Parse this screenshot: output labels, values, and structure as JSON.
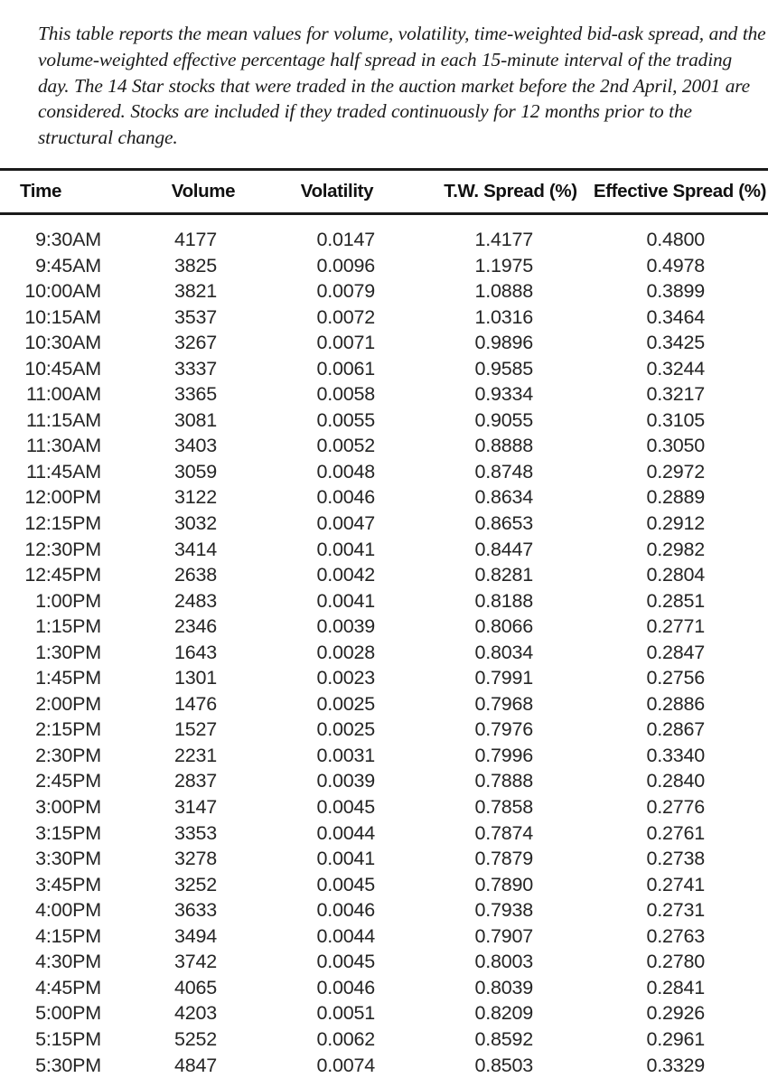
{
  "caption": {
    "text": "This table reports the mean values for volume, volatility, time-weighted bid-ask spread, and the volume-weighted effective percentage half spread in each 15-minute interval of the trading day. The 14 Star stocks that were traded in the auction market before the 2nd April, 2001 are considered. Stocks are included if they traded continuously for 12 months prior to the structural change."
  },
  "table": {
    "columns": [
      {
        "key": "time",
        "label": "Time"
      },
      {
        "key": "volume",
        "label": "Volume"
      },
      {
        "key": "volatility",
        "label": "Volatility"
      },
      {
        "key": "tw_spread",
        "label": "T.W. Spread (%)"
      },
      {
        "key": "eff_spread",
        "label": "Effective Spread (%)"
      }
    ],
    "rows": [
      {
        "time": "9:30AM",
        "volume": "4177",
        "volatility": "0.0147",
        "tw_spread": "1.4177",
        "eff_spread": "0.4800"
      },
      {
        "time": "9:45AM",
        "volume": "3825",
        "volatility": "0.0096",
        "tw_spread": "1.1975",
        "eff_spread": "0.4978"
      },
      {
        "time": "10:00AM",
        "volume": "3821",
        "volatility": "0.0079",
        "tw_spread": "1.0888",
        "eff_spread": "0.3899"
      },
      {
        "time": "10:15AM",
        "volume": "3537",
        "volatility": "0.0072",
        "tw_spread": "1.0316",
        "eff_spread": "0.3464"
      },
      {
        "time": "10:30AM",
        "volume": "3267",
        "volatility": "0.0071",
        "tw_spread": "0.9896",
        "eff_spread": "0.3425"
      },
      {
        "time": "10:45AM",
        "volume": "3337",
        "volatility": "0.0061",
        "tw_spread": "0.9585",
        "eff_spread": "0.3244"
      },
      {
        "time": "11:00AM",
        "volume": "3365",
        "volatility": "0.0058",
        "tw_spread": "0.9334",
        "eff_spread": "0.3217"
      },
      {
        "time": "11:15AM",
        "volume": "3081",
        "volatility": "0.0055",
        "tw_spread": "0.9055",
        "eff_spread": "0.3105"
      },
      {
        "time": "11:30AM",
        "volume": "3403",
        "volatility": "0.0052",
        "tw_spread": "0.8888",
        "eff_spread": "0.3050"
      },
      {
        "time": "11:45AM",
        "volume": "3059",
        "volatility": "0.0048",
        "tw_spread": "0.8748",
        "eff_spread": "0.2972"
      },
      {
        "time": "12:00PM",
        "volume": "3122",
        "volatility": "0.0046",
        "tw_spread": "0.8634",
        "eff_spread": "0.2889"
      },
      {
        "time": "12:15PM",
        "volume": "3032",
        "volatility": "0.0047",
        "tw_spread": "0.8653",
        "eff_spread": "0.2912"
      },
      {
        "time": "12:30PM",
        "volume": "3414",
        "volatility": "0.0041",
        "tw_spread": "0.8447",
        "eff_spread": "0.2982"
      },
      {
        "time": "12:45PM",
        "volume": "2638",
        "volatility": "0.0042",
        "tw_spread": "0.8281",
        "eff_spread": "0.2804"
      },
      {
        "time": "1:00PM",
        "volume": "2483",
        "volatility": "0.0041",
        "tw_spread": "0.8188",
        "eff_spread": "0.2851"
      },
      {
        "time": "1:15PM",
        "volume": "2346",
        "volatility": "0.0039",
        "tw_spread": "0.8066",
        "eff_spread": "0.2771"
      },
      {
        "time": "1:30PM",
        "volume": "1643",
        "volatility": "0.0028",
        "tw_spread": "0.8034",
        "eff_spread": "0.2847"
      },
      {
        "time": "1:45PM",
        "volume": "1301",
        "volatility": "0.0023",
        "tw_spread": "0.7991",
        "eff_spread": "0.2756"
      },
      {
        "time": "2:00PM",
        "volume": "1476",
        "volatility": "0.0025",
        "tw_spread": "0.7968",
        "eff_spread": "0.2886"
      },
      {
        "time": "2:15PM",
        "volume": "1527",
        "volatility": "0.0025",
        "tw_spread": "0.7976",
        "eff_spread": "0.2867"
      },
      {
        "time": "2:30PM",
        "volume": "2231",
        "volatility": "0.0031",
        "tw_spread": "0.7996",
        "eff_spread": "0.3340"
      },
      {
        "time": "2:45PM",
        "volume": "2837",
        "volatility": "0.0039",
        "tw_spread": "0.7888",
        "eff_spread": "0.2840"
      },
      {
        "time": "3:00PM",
        "volume": "3147",
        "volatility": "0.0045",
        "tw_spread": "0.7858",
        "eff_spread": "0.2776"
      },
      {
        "time": "3:15PM",
        "volume": "3353",
        "volatility": "0.0044",
        "tw_spread": "0.7874",
        "eff_spread": "0.2761"
      },
      {
        "time": "3:30PM",
        "volume": "3278",
        "volatility": "0.0041",
        "tw_spread": "0.7879",
        "eff_spread": "0.2738"
      },
      {
        "time": "3:45PM",
        "volume": "3252",
        "volatility": "0.0045",
        "tw_spread": "0.7890",
        "eff_spread": "0.2741"
      },
      {
        "time": "4:00PM",
        "volume": "3633",
        "volatility": "0.0046",
        "tw_spread": "0.7938",
        "eff_spread": "0.2731"
      },
      {
        "time": "4:15PM",
        "volume": "3494",
        "volatility": "0.0044",
        "tw_spread": "0.7907",
        "eff_spread": "0.2763"
      },
      {
        "time": "4:30PM",
        "volume": "3742",
        "volatility": "0.0045",
        "tw_spread": "0.8003",
        "eff_spread": "0.2780"
      },
      {
        "time": "4:45PM",
        "volume": "4065",
        "volatility": "0.0046",
        "tw_spread": "0.8039",
        "eff_spread": "0.2841"
      },
      {
        "time": "5:00PM",
        "volume": "4203",
        "volatility": "0.0051",
        "tw_spread": "0.8209",
        "eff_spread": "0.2926"
      },
      {
        "time": "5:15PM",
        "volume": "5252",
        "volatility": "0.0062",
        "tw_spread": "0.8592",
        "eff_spread": "0.2961"
      },
      {
        "time": "5:30PM",
        "volume": "4847",
        "volatility": "0.0074",
        "tw_spread": "0.8503",
        "eff_spread": "0.3329"
      }
    ]
  },
  "colors": {
    "text": "#1b1b1b",
    "rule": "#1b1b1b",
    "background": "#ffffff"
  }
}
